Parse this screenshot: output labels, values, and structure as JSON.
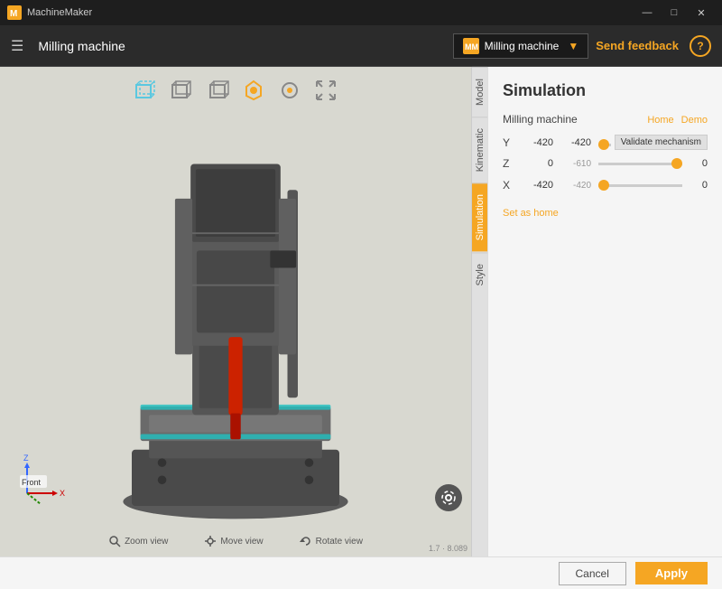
{
  "titlebar": {
    "title": "MachineMaker",
    "minimize": "—",
    "maximize": "□",
    "close": "✕"
  },
  "topbar": {
    "menu_icon": "☰",
    "title": "Milling machine",
    "machine_label": "Milling machine",
    "send_feedback": "Send feedback",
    "help": "?"
  },
  "tabs": {
    "model": "Model",
    "kinematic": "Kinematic",
    "simulation": "Simulation",
    "style": "Style"
  },
  "panel": {
    "title": "Simulation",
    "subtitle": "Milling machine",
    "home_link": "Home",
    "demo_link": "Demo",
    "validate_btn": "Validate mechanism",
    "set_home": "Set as home",
    "axes": [
      {
        "label": "Y",
        "value": "-420",
        "slider_value": -420,
        "min": -420,
        "max": 0,
        "end": "-420"
      },
      {
        "label": "Z",
        "value": "0",
        "slider_value": 0,
        "min": -610,
        "max": 0,
        "end": "0"
      },
      {
        "label": "X",
        "value": "-420",
        "slider_value": -420,
        "min": -420,
        "max": 0,
        "end": "0"
      }
    ]
  },
  "bottom": {
    "cancel": "Cancel",
    "apply": "Apply"
  },
  "viewport": {
    "zoom_label": "Zoom view",
    "move_label": "Move view",
    "rotate_label": "Rotate view",
    "version": "1.7 · 8.089",
    "orientation": "Front"
  }
}
